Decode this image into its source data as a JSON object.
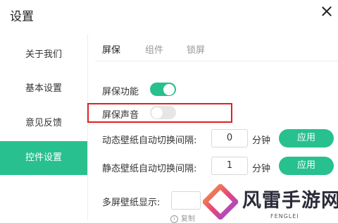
{
  "window": {
    "title": "设置"
  },
  "sidebar": {
    "items": [
      {
        "label": "关于我们",
        "active": false
      },
      {
        "label": "基本设置",
        "active": false
      },
      {
        "label": "意见反馈",
        "active": false
      },
      {
        "label": "控件设置",
        "active": true
      }
    ]
  },
  "tabs": [
    {
      "label": "屏保",
      "active": true
    },
    {
      "label": "组件",
      "active": false
    },
    {
      "label": "锁屏",
      "active": false
    }
  ],
  "settings": {
    "screensaver_feature": {
      "label": "屏保功能",
      "enabled": true
    },
    "screensaver_sound": {
      "label": "屏保声音",
      "enabled": false
    },
    "dynamic_wallpaper": {
      "label": "动态壁纸自动切换间隔:",
      "value": "0",
      "unit": "分钟",
      "apply_label": "应用"
    },
    "static_wallpaper": {
      "label": "静态壁纸自动切换间隔:",
      "value": "1",
      "unit": "分钟",
      "apply_label": "应用"
    },
    "multi_screen": {
      "label": "多屏壁纸显示:",
      "value": "",
      "note": "复制"
    }
  },
  "watermark": {
    "text": "风雷手游网",
    "subtext": "FENGLEI"
  },
  "colors": {
    "accent": "#28c08e",
    "highlight": "#e02020"
  }
}
